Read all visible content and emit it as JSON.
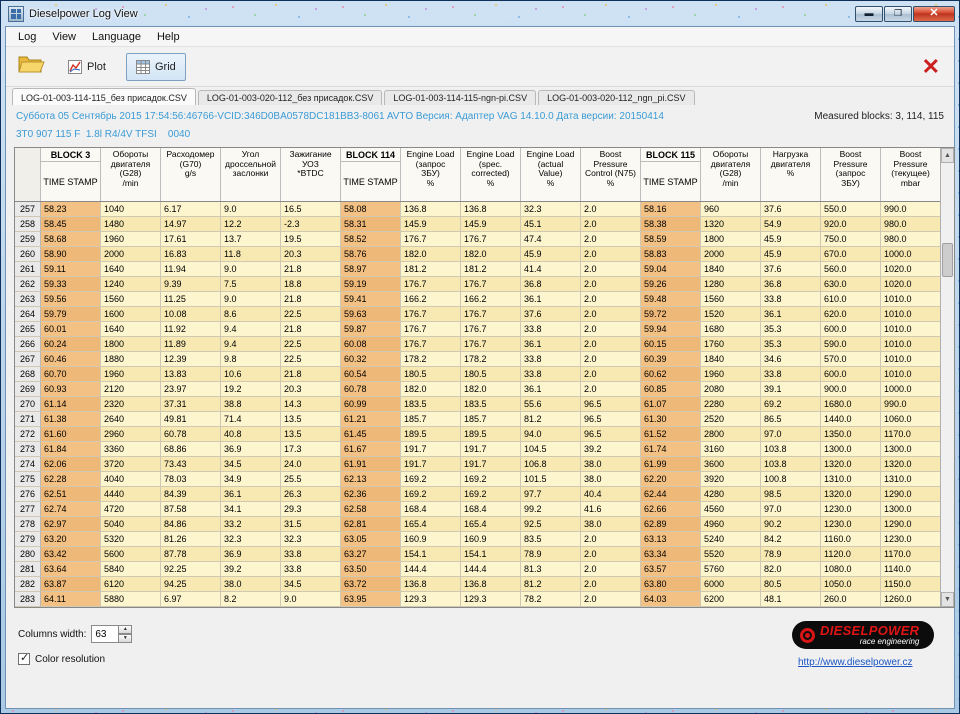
{
  "title": "Dieselpower Log View",
  "menu": [
    "Log",
    "View",
    "Language",
    "Help"
  ],
  "toolbar": {
    "plot": "Plot",
    "grid": "Grid"
  },
  "tabs": [
    "LOG-01-003-114-115_без присадок.CSV",
    "LOG-01-003-020-112_без присадок.CSV",
    "LOG-01-003-114-115-ngn-pi.CSV",
    "LOG-01-003-020-112_ngn_pi.CSV"
  ],
  "active_tab": 0,
  "info": {
    "line1": "Суббота 05 Сентябрь 2015 17:54:56:46766-VCID:346D0BA0578DC181BB3-8061 AVTO Версия: Адаптер VAG 14.10.0 Дата версии: 20150414",
    "measured": "Measured blocks: 3, 114, 115",
    "line2": "3T0 907 115 F  1.8l R4/4V TFSI    0040"
  },
  "grid": {
    "columns": [
      {
        "block": "BLOCK 3",
        "title": "TIME STAMP"
      },
      {
        "title": "Обороты\nдвигателя\n(G28)\n/min"
      },
      {
        "title": "Расходомер\n(G70)\ng/s"
      },
      {
        "title": "Угол\nдроссельной\nзаслонки"
      },
      {
        "title": "Зажигание\nУОЗ\n*BTDC"
      },
      {
        "block": "BLOCK 114",
        "title": "TIME STAMP"
      },
      {
        "title": "Engine Load\n(запрос\nЗБУ)\n%"
      },
      {
        "title": "Engine Load\n(spec.\ncorrected)\n%"
      },
      {
        "title": "Engine Load\n(actual\nValue)\n%"
      },
      {
        "title": "Boost\nPressure\nControl (N75)\n%"
      },
      {
        "block": "BLOCK 115",
        "title": "TIME STAMP"
      },
      {
        "title": "Обороты\nдвигателя\n(G28)\n/min"
      },
      {
        "title": "Нагрузка\nдвигателя\n%"
      },
      {
        "title": "Boost\nPressure\n(запрос\nЗБУ)"
      },
      {
        "title": "Boost\nPressure\n(текущее)\nmbar"
      }
    ],
    "ts_columns": [
      0,
      5,
      10
    ],
    "rows": [
      {
        "n": 257,
        "cells": [
          "58.23",
          "1040",
          "6.17",
          "9.0",
          "16.5",
          "58.08",
          "136.8",
          "136.8",
          "32.3",
          "2.0",
          "58.16",
          "960",
          "37.6",
          "550.0",
          "990.0"
        ]
      },
      {
        "n": 258,
        "cells": [
          "58.45",
          "1480",
          "14.97",
          "12.2",
          "-2.3",
          "58.31",
          "145.9",
          "145.9",
          "45.1",
          "2.0",
          "58.38",
          "1320",
          "54.9",
          "920.0",
          "980.0"
        ]
      },
      {
        "n": 259,
        "cells": [
          "58.68",
          "1960",
          "17.61",
          "13.7",
          "19.5",
          "58.52",
          "176.7",
          "176.7",
          "47.4",
          "2.0",
          "58.59",
          "1800",
          "45.9",
          "750.0",
          "980.0"
        ]
      },
      {
        "n": 260,
        "cells": [
          "58.90",
          "2000",
          "16.83",
          "11.8",
          "20.3",
          "58.76",
          "182.0",
          "182.0",
          "45.9",
          "2.0",
          "58.83",
          "2000",
          "45.9",
          "670.0",
          "1000.0"
        ]
      },
      {
        "n": 261,
        "cells": [
          "59.11",
          "1640",
          "11.94",
          "9.0",
          "21.8",
          "58.97",
          "181.2",
          "181.2",
          "41.4",
          "2.0",
          "59.04",
          "1840",
          "37.6",
          "560.0",
          "1020.0"
        ]
      },
      {
        "n": 262,
        "cells": [
          "59.33",
          "1240",
          "9.39",
          "7.5",
          "18.8",
          "59.19",
          "176.7",
          "176.7",
          "36.8",
          "2.0",
          "59.26",
          "1280",
          "36.8",
          "630.0",
          "1020.0"
        ]
      },
      {
        "n": 263,
        "cells": [
          "59.56",
          "1560",
          "11.25",
          "9.0",
          "21.8",
          "59.41",
          "166.2",
          "166.2",
          "36.1",
          "2.0",
          "59.48",
          "1560",
          "33.8",
          "610.0",
          "1010.0"
        ]
      },
      {
        "n": 264,
        "cells": [
          "59.79",
          "1600",
          "10.08",
          "8.6",
          "22.5",
          "59.63",
          "176.7",
          "176.7",
          "37.6",
          "2.0",
          "59.72",
          "1520",
          "36.1",
          "620.0",
          "1010.0"
        ]
      },
      {
        "n": 265,
        "cells": [
          "60.01",
          "1640",
          "11.92",
          "9.4",
          "21.8",
          "59.87",
          "176.7",
          "176.7",
          "33.8",
          "2.0",
          "59.94",
          "1680",
          "35.3",
          "600.0",
          "1010.0"
        ]
      },
      {
        "n": 266,
        "cells": [
          "60.24",
          "1800",
          "11.89",
          "9.4",
          "22.5",
          "60.08",
          "176.7",
          "176.7",
          "36.1",
          "2.0",
          "60.15",
          "1760",
          "35.3",
          "590.0",
          "1010.0"
        ]
      },
      {
        "n": 267,
        "cells": [
          "60.46",
          "1880",
          "12.39",
          "9.8",
          "22.5",
          "60.32",
          "178.2",
          "178.2",
          "33.8",
          "2.0",
          "60.39",
          "1840",
          "34.6",
          "570.0",
          "1010.0"
        ]
      },
      {
        "n": 268,
        "cells": [
          "60.70",
          "1960",
          "13.83",
          "10.6",
          "21.8",
          "60.54",
          "180.5",
          "180.5",
          "33.8",
          "2.0",
          "60.62",
          "1960",
          "33.8",
          "600.0",
          "1010.0"
        ]
      },
      {
        "n": 269,
        "cells": [
          "60.93",
          "2120",
          "23.97",
          "19.2",
          "20.3",
          "60.78",
          "182.0",
          "182.0",
          "36.1",
          "2.0",
          "60.85",
          "2080",
          "39.1",
          "900.0",
          "1000.0"
        ]
      },
      {
        "n": 270,
        "cells": [
          "61.14",
          "2320",
          "37.31",
          "38.8",
          "14.3",
          "60.99",
          "183.5",
          "183.5",
          "55.6",
          "96.5",
          "61.07",
          "2280",
          "69.2",
          "1680.0",
          "990.0"
        ]
      },
      {
        "n": 271,
        "cells": [
          "61.38",
          "2640",
          "49.81",
          "71.4",
          "13.5",
          "61.21",
          "185.7",
          "185.7",
          "81.2",
          "96.5",
          "61.30",
          "2520",
          "86.5",
          "1440.0",
          "1060.0"
        ]
      },
      {
        "n": 272,
        "cells": [
          "61.60",
          "2960",
          "60.78",
          "40.8",
          "13.5",
          "61.45",
          "189.5",
          "189.5",
          "94.0",
          "96.5",
          "61.52",
          "2800",
          "97.0",
          "1350.0",
          "1170.0"
        ]
      },
      {
        "n": 273,
        "cells": [
          "61.84",
          "3360",
          "68.86",
          "36.9",
          "17.3",
          "61.67",
          "191.7",
          "191.7",
          "104.5",
          "39.2",
          "61.74",
          "3160",
          "103.8",
          "1300.0",
          "1300.0"
        ]
      },
      {
        "n": 274,
        "cells": [
          "62.06",
          "3720",
          "73.43",
          "34.5",
          "24.0",
          "61.91",
          "191.7",
          "191.7",
          "106.8",
          "38.0",
          "61.99",
          "3600",
          "103.8",
          "1320.0",
          "1320.0"
        ]
      },
      {
        "n": 275,
        "cells": [
          "62.28",
          "4040",
          "78.03",
          "34.9",
          "25.5",
          "62.13",
          "169.2",
          "169.2",
          "101.5",
          "38.0",
          "62.20",
          "3920",
          "100.8",
          "1310.0",
          "1310.0"
        ]
      },
      {
        "n": 276,
        "cells": [
          "62.51",
          "4440",
          "84.39",
          "36.1",
          "26.3",
          "62.36",
          "169.2",
          "169.2",
          "97.7",
          "40.4",
          "62.44",
          "4280",
          "98.5",
          "1320.0",
          "1290.0"
        ]
      },
      {
        "n": 277,
        "cells": [
          "62.74",
          "4720",
          "87.58",
          "34.1",
          "29.3",
          "62.58",
          "168.4",
          "168.4",
          "99.2",
          "41.6",
          "62.66",
          "4560",
          "97.0",
          "1230.0",
          "1300.0"
        ]
      },
      {
        "n": 278,
        "cells": [
          "62.97",
          "5040",
          "84.86",
          "33.2",
          "31.5",
          "62.81",
          "165.4",
          "165.4",
          "92.5",
          "38.0",
          "62.89",
          "4960",
          "90.2",
          "1230.0",
          "1290.0"
        ]
      },
      {
        "n": 279,
        "cells": [
          "63.20",
          "5320",
          "81.26",
          "32.3",
          "32.3",
          "63.05",
          "160.9",
          "160.9",
          "83.5",
          "2.0",
          "63.13",
          "5240",
          "84.2",
          "1160.0",
          "1230.0"
        ]
      },
      {
        "n": 280,
        "cells": [
          "63.42",
          "5600",
          "87.78",
          "36.9",
          "33.8",
          "63.27",
          "154.1",
          "154.1",
          "78.9",
          "2.0",
          "63.34",
          "5520",
          "78.9",
          "1120.0",
          "1170.0"
        ]
      },
      {
        "n": 281,
        "cells": [
          "63.64",
          "5840",
          "92.25",
          "39.2",
          "33.8",
          "63.50",
          "144.4",
          "144.4",
          "81.3",
          "2.0",
          "63.57",
          "5760",
          "82.0",
          "1080.0",
          "1140.0"
        ]
      },
      {
        "n": 282,
        "cells": [
          "63.87",
          "6120",
          "94.25",
          "38.0",
          "34.5",
          "63.72",
          "136.8",
          "136.8",
          "81.2",
          "2.0",
          "63.80",
          "6000",
          "80.5",
          "1050.0",
          "1150.0"
        ]
      },
      {
        "n": 283,
        "cells": [
          "64.11",
          "5880",
          "6.97",
          "8.2",
          "9.0",
          "63.95",
          "129.3",
          "129.3",
          "78.2",
          "2.0",
          "64.03",
          "6200",
          "48.1",
          "260.0",
          "1260.0"
        ]
      }
    ]
  },
  "footer": {
    "columns_width_label": "Columns width:",
    "columns_width": "63",
    "color_resolution_label": "Color resolution",
    "logo_main": "DIESELPOWER",
    "logo_sub": "race engineering",
    "link": "http://www.dieselpower.cz"
  }
}
